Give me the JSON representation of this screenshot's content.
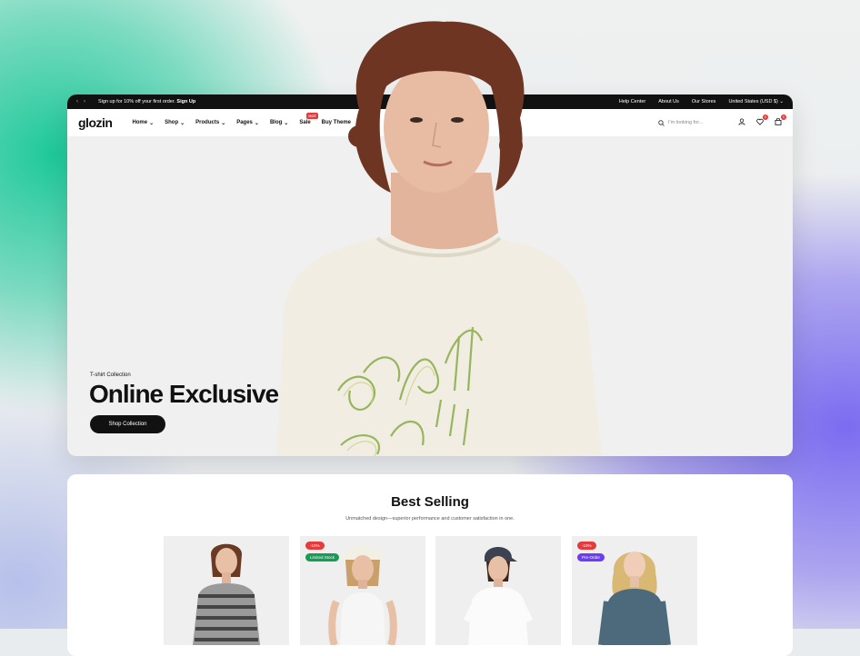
{
  "topbar": {
    "promo_text": "Sign up for 10% off your first order.",
    "promo_link": "Sign Up",
    "links": [
      "Help Center",
      "About Us",
      "Our Stores",
      "United States (USD $)"
    ]
  },
  "nav": {
    "logo": "glozin",
    "menu": [
      "Home",
      "Shop",
      "Products",
      "Pages",
      "Blog",
      "Sale",
      "Buy Theme"
    ],
    "hot_badge": "HOT",
    "search_placeholder": "I'm looking for...",
    "wishlist_count": "0",
    "cart_count": "0"
  },
  "hero": {
    "subtitle": "T-shirt Collection",
    "title": "Online Exclusive",
    "button": "Shop Collection"
  },
  "best_selling": {
    "title": "Best Selling",
    "subtitle": "Unmatched design—superior performance and customer satisfaction in one.",
    "products": [
      {
        "tags": []
      },
      {
        "tags": [
          "-10%",
          "Limited Stock"
        ]
      },
      {
        "tags": []
      },
      {
        "tags": [
          "-10%",
          "Pre-Order"
        ]
      }
    ]
  },
  "colors": {
    "accent_red": "#e43c3c",
    "limited_green": "#1a9a55",
    "preorder_purple": "#6b3ef2",
    "dark": "#111111"
  }
}
